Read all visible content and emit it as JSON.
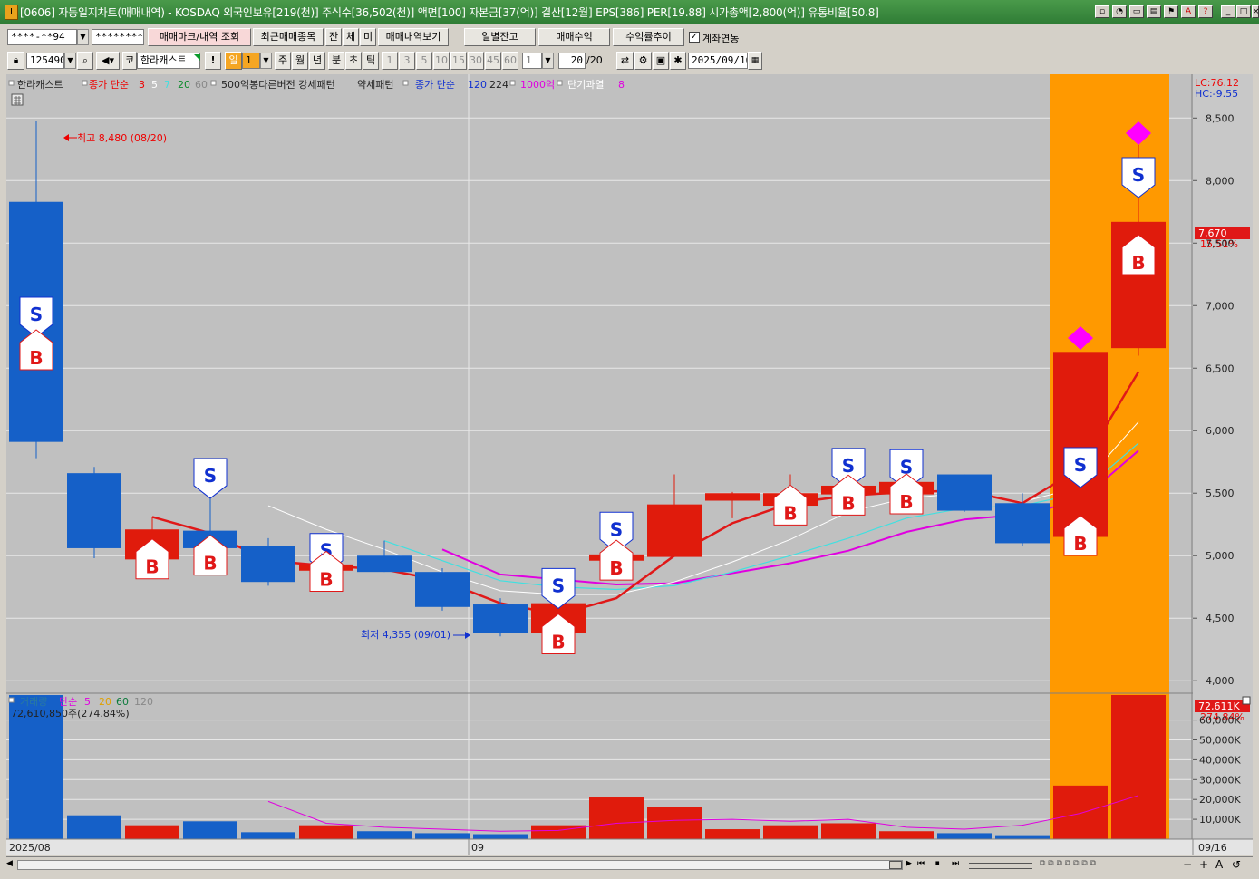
{
  "window": {
    "title": "[0606] 자동일지차트(매매내역) - KOSDAQ 외국인보유[219(천)] 주식수[36,502(천)] 액면[100] 자본금[37(억)] 결산[12월] EPS[386] PER[19.88] 시가총액[2,800(억)] 유통비율[50.8]",
    "app_icon": "I",
    "buttons": [
      "restore-icon",
      "help-icon",
      "window-icon",
      "tile-icon",
      "bookmark-icon",
      "font-icon",
      "question-icon",
      "minimize-icon",
      "maximize-icon",
      "close-icon"
    ]
  },
  "toolbar1": {
    "account": "****-**94",
    "password": "*********",
    "btn_markview": "매매마크/내역 조회",
    "btn_recent": "최근매매종목",
    "btn_jan": "잔",
    "btn_che": "체",
    "btn_mi": "미",
    "btn_history": "매매내역보기",
    "btn_daily": "일별잔고",
    "btn_profit": "매매수익",
    "btn_return": "수익률추이",
    "chk_link_label": "계좌연동",
    "chk_link_checked": "✓"
  },
  "toolbar2": {
    "code": "125490",
    "btn_ko": "코",
    "stock_name": "한라캐스트",
    "btn_excl": "!",
    "period_day": "일",
    "period_n": "1",
    "periods": [
      "주",
      "월",
      "년",
      "분",
      "초",
      "틱"
    ],
    "intervals": [
      "1",
      "3",
      "5",
      "10",
      "15",
      "30",
      "45",
      "60"
    ],
    "interval_sel": "1",
    "count": "20",
    "count_total": "/20",
    "date": "2025/09/16"
  },
  "price_legend": {
    "name": "한라캐스트",
    "ma_label": "종가 단순",
    "ma_periods": [
      "3",
      "5",
      "7",
      "20",
      "60"
    ],
    "pattern": "500억봉다른버전 강세패턴",
    "weak": "약세패턴",
    "ma2_label": "종가 단순",
    "ma2_periods": [
      "120",
      "224"
    ],
    "tril": "1000억",
    "overheat": "단기과열",
    "overheat_n": "8"
  },
  "volume_legend": {
    "label": "거래량",
    "ma_label": "단순",
    "ma_periods": [
      "5",
      "20",
      "60",
      "120"
    ],
    "current": "72,610,850주(274.84%)"
  },
  "annotations": {
    "high": "최고 8,480 (08/20)",
    "low": "최저 4,355 (09/01)"
  },
  "right_axis": {
    "lc": "LC:76.12",
    "hc": "HC:-9.55",
    "last_price": "7,670",
    "last_change": "15.51%",
    "ticks": [
      "8,500",
      "8,000",
      "7,500",
      "7,000",
      "6,500",
      "6,000",
      "5,500",
      "5,000",
      "4,500",
      "4,000"
    ],
    "vol_last": "72,611K",
    "vol_change": "274.84%",
    "vol_ticks": [
      "60,000K",
      "50,000K",
      "40,000K",
      "30,000K",
      "20,000K",
      "10,000K"
    ]
  },
  "x_axis": {
    "labels": [
      "2025/08",
      "09",
      "09/16"
    ]
  },
  "chart_data": {
    "type": "candlestick",
    "ylim": [
      3900,
      8850
    ],
    "vol_ylim": [
      0,
      72610
    ],
    "candles": [
      {
        "o": 7830,
        "h": 8480,
        "l": 5780,
        "c": 5910,
        "v": 72600
      },
      {
        "o": 5660,
        "h": 5710,
        "l": 4980,
        "c": 5060,
        "v": 12000
      },
      {
        "o": 4970,
        "h": 5310,
        "l": 4960,
        "c": 5210,
        "v": 7000
      },
      {
        "o": 5200,
        "h": 5560,
        "l": 4990,
        "c": 5060,
        "v": 9000
      },
      {
        "o": 5080,
        "h": 5140,
        "l": 4760,
        "c": 4790,
        "v": 3500
      },
      {
        "o": 4880,
        "h": 4960,
        "l": 4860,
        "c": 4930,
        "v": 7000
      },
      {
        "o": 5000,
        "h": 5120,
        "l": 4870,
        "c": 4870,
        "v": 4000
      },
      {
        "o": 4870,
        "h": 4900,
        "l": 4560,
        "c": 4590,
        "v": 3000
      },
      {
        "o": 4610,
        "h": 4660,
        "l": 4355,
        "c": 4380,
        "v": 2500
      },
      {
        "o": 4380,
        "h": 4680,
        "l": 4360,
        "c": 4620,
        "v": 7000
      },
      {
        "o": 4960,
        "h": 5130,
        "l": 4950,
        "c": 5010,
        "v": 21000
      },
      {
        "o": 4990,
        "h": 5650,
        "l": 4990,
        "c": 5410,
        "v": 16000
      },
      {
        "o": 5440,
        "h": 5510,
        "l": 5300,
        "c": 5500,
        "v": 5000
      },
      {
        "o": 5400,
        "h": 5650,
        "l": 5390,
        "c": 5500,
        "v": 7000
      },
      {
        "o": 5490,
        "h": 5640,
        "l": 5470,
        "c": 5560,
        "v": 8000
      },
      {
        "o": 5490,
        "h": 5630,
        "l": 5480,
        "c": 5590,
        "v": 4000
      },
      {
        "o": 5650,
        "h": 5650,
        "l": 5350,
        "c": 5360,
        "v": 3000
      },
      {
        "o": 5420,
        "h": 5500,
        "l": 5080,
        "c": 5100,
        "v": 2000
      },
      {
        "o": 5150,
        "h": 6600,
        "l": 5140,
        "c": 6630,
        "v": 27000
      },
      {
        "o": 6660,
        "h": 8300,
        "l": 6600,
        "c": 7670,
        "v": 72610
      }
    ],
    "ma3": [
      null,
      null,
      5310,
      5180,
      4960,
      4920,
      4890,
      4800,
      4620,
      4530,
      4660,
      5000,
      5260,
      5420,
      5480,
      5510,
      5520,
      5420,
      5700,
      6470
    ],
    "ma5": [
      null,
      null,
      null,
      null,
      5400,
      5210,
      5050,
      4870,
      4720,
      4690,
      4690,
      4790,
      4950,
      5130,
      5350,
      5460,
      5500,
      5430,
      5550,
      6070
    ],
    "ma7": [
      null,
      null,
      null,
      null,
      null,
      null,
      5120,
      4960,
      4800,
      4750,
      4730,
      4760,
      4870,
      5000,
      5140,
      5300,
      5380,
      5400,
      5500,
      5900
    ],
    "ma20": [
      null,
      null,
      null,
      null,
      null,
      null,
      null,
      5050,
      4850,
      4810,
      4770,
      4780,
      4860,
      4940,
      5040,
      5190,
      5290,
      5330,
      5440,
      5840
    ],
    "buy_marks": [
      0,
      2,
      3,
      5,
      9,
      10,
      13,
      14,
      15,
      18,
      19
    ],
    "sell_marks": [
      0,
      3,
      5,
      9,
      10,
      14,
      15,
      18,
      19
    ],
    "overheat_marks": [
      18,
      19
    ],
    "highlight_range": [
      18,
      19
    ],
    "vol_ma": [
      null,
      null,
      null,
      null,
      19000,
      8000,
      6000,
      5000,
      4000,
      4400,
      8000,
      9500,
      10000,
      9000,
      10000,
      6000,
      5000,
      7000,
      13000,
      22000
    ]
  },
  "scrollbar": {
    "buttons": [
      "◀",
      "▶",
      "⏮",
      "⏹",
      "⏭",
      "−",
      "+",
      "A",
      "↺"
    ]
  }
}
